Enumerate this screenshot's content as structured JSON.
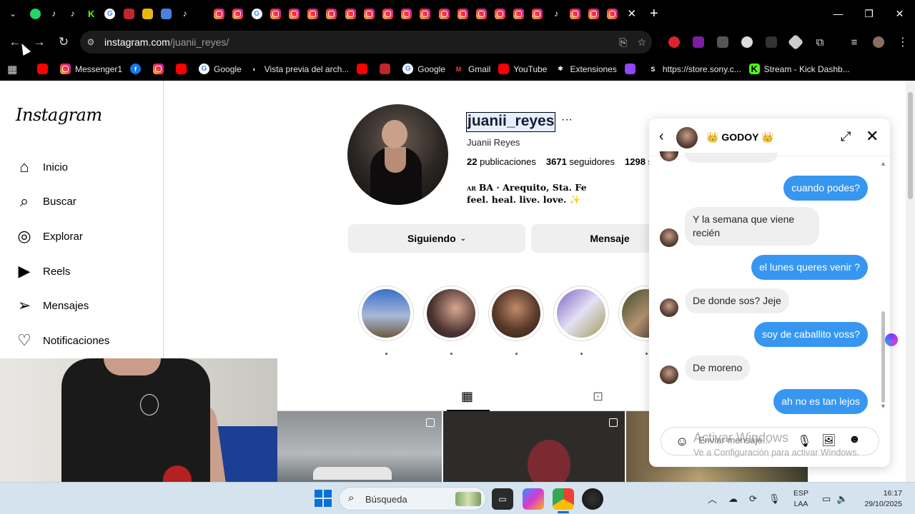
{
  "browser": {
    "tab_close": "✕",
    "tab_new": "+",
    "url_domain": "instagram.com",
    "url_path": "/juanii_reyes/",
    "window_controls": [
      "—",
      "❐",
      "✕"
    ]
  },
  "bookmarks": [
    {
      "label": "",
      "icon": "youtube-icon"
    },
    {
      "label": "Messenger1",
      "icon": "instagram-icon"
    },
    {
      "label": "",
      "icon": "facebook-icon"
    },
    {
      "label": "",
      "icon": "instagram-icon"
    },
    {
      "label": "",
      "icon": "youtube-icon"
    },
    {
      "label": "Google",
      "icon": "google-icon"
    },
    {
      "label": "Vista previa del arch...",
      "icon": "chrome-icon"
    },
    {
      "label": "",
      "icon": "youtube-icon"
    },
    {
      "label": "",
      "icon": "red-app-icon"
    },
    {
      "label": "Google",
      "icon": "google-icon"
    },
    {
      "label": "Gmail",
      "icon": "gmail-icon"
    },
    {
      "label": "YouTube",
      "icon": "youtube-icon"
    },
    {
      "label": "Extensiones",
      "icon": "puzzle-icon"
    },
    {
      "label": "",
      "icon": "twitch-icon"
    },
    {
      "label": "https://store.sony.c...",
      "icon": "sony-icon"
    },
    {
      "label": "Stream - Kick Dashb...",
      "icon": "kick-icon"
    }
  ],
  "sidebar": {
    "logo": "Instagram",
    "items": [
      {
        "label": "Inicio",
        "icon": "home-icon"
      },
      {
        "label": "Buscar",
        "icon": "search-icon"
      },
      {
        "label": "Explorar",
        "icon": "compass-icon"
      },
      {
        "label": "Reels",
        "icon": "reels-icon"
      },
      {
        "label": "Mensajes",
        "icon": "messages-icon"
      },
      {
        "label": "Notificaciones",
        "icon": "heart-icon"
      }
    ]
  },
  "profile": {
    "username": "juanii_reyes",
    "more": "···",
    "full_name": "Juanii Reyes",
    "posts": "22",
    "posts_label": "publicaciones",
    "followers": "3671",
    "followers_label": "seguidores",
    "following": "1298",
    "following_label": "s",
    "bio_flag": "AR",
    "bio_line1": "BA · Arequito, Sta. Fe",
    "bio_line2": "feel. heal. live. love. ✨",
    "follow_button": "Siguiendo",
    "message_button": "Mensaje"
  },
  "chat": {
    "title": "👑 GODOY 👑",
    "messages": [
      {
        "from": "me",
        "text": "cuando podes?"
      },
      {
        "from": "them",
        "text": "Y la semana que viene recién"
      },
      {
        "from": "me",
        "text": "el lunes queres venir ?"
      },
      {
        "from": "them",
        "text": "De donde sos? Jeje"
      },
      {
        "from": "me",
        "text": "soy de caballito voss?"
      },
      {
        "from": "them",
        "text": "De moreno"
      },
      {
        "from": "me",
        "text": "ah no es tan lejos"
      }
    ],
    "composer_placeholder": "Enviar mensaje..."
  },
  "watermark": {
    "line1": "Activar Windows",
    "line2": "Ve a Configuración para activar Windows."
  },
  "taskbar": {
    "search_label": "Búsqueda",
    "lang1": "ESP",
    "lang2": "LAA",
    "time": "16:17",
    "date": "29/10/2025"
  }
}
